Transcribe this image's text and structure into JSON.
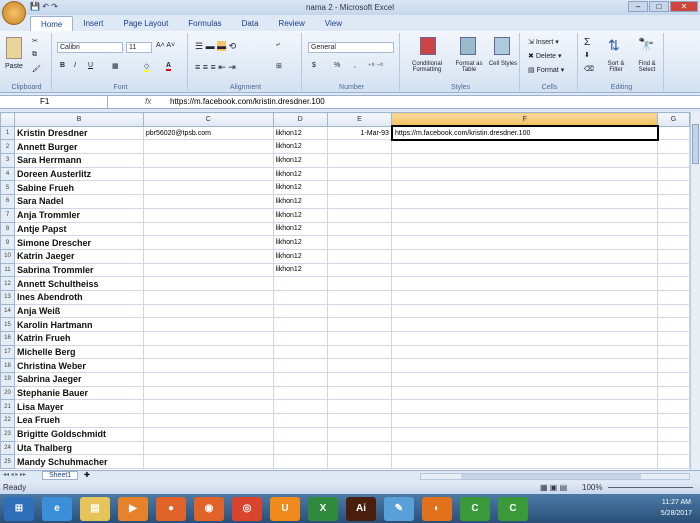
{
  "window": {
    "title": "nama 2 - Microsoft Excel"
  },
  "ribbon": {
    "tabs": [
      "Home",
      "Insert",
      "Page Layout",
      "Formulas",
      "Data",
      "Review",
      "View"
    ],
    "active_tab": "Home",
    "groups": {
      "clipboard": "Clipboard",
      "font": "Font",
      "alignment": "Alignment",
      "number": "Number",
      "styles": "Styles",
      "cells": "Cells",
      "editing": "Editing"
    },
    "paste": "Paste",
    "font_name": "Calibri",
    "font_size": "11",
    "number_format": "General",
    "conditional_formatting": "Conditional Formatting",
    "format_as_table": "Format as Table",
    "cell_styles": "Cell Styles",
    "insert": "Insert",
    "delete": "Delete",
    "format": "Format",
    "sort_filter": "Sort & Filter",
    "find_select": "Find & Select",
    "bold": "B",
    "italic": "I",
    "underline": "U",
    "currency": "$",
    "percent": "%",
    "comma": ","
  },
  "formula_bar": {
    "cell_ref": "F1",
    "fx": "fx",
    "value": "https://m.facebook.com/kristin.dresdner.100"
  },
  "columns": [
    "B",
    "C",
    "D",
    "E",
    "F",
    "G"
  ],
  "selected_column": "F",
  "rows": [
    {
      "n": "1",
      "b": "Kristin Dresdner",
      "c": "pbr56020@tpsb.com",
      "d": "likhon12",
      "e": "1-Mar-93",
      "f": "https://m.facebook.com/kristin.dresdner.100"
    },
    {
      "n": "2",
      "b": "Annett Burger",
      "d": "likhon12"
    },
    {
      "n": "3",
      "b": "Sara Herrmann",
      "d": "likhon12"
    },
    {
      "n": "4",
      "b": "Doreen Austerlitz",
      "d": "likhon12"
    },
    {
      "n": "5",
      "b": "Sabine Frueh",
      "d": "likhon12"
    },
    {
      "n": "6",
      "b": "Sara Nadel",
      "d": "likhon12"
    },
    {
      "n": "7",
      "b": "Anja Trommler",
      "d": "likhon12"
    },
    {
      "n": "8",
      "b": "Antje Papst",
      "d": "likhon12"
    },
    {
      "n": "9",
      "b": "Simone Drescher",
      "d": "likhon12"
    },
    {
      "n": "10",
      "b": "Katrin Jaeger",
      "d": "likhon12"
    },
    {
      "n": "11",
      "b": "Sabrina Trommler",
      "d": "likhon12"
    },
    {
      "n": "12",
      "b": "Annett Schultheiss"
    },
    {
      "n": "13",
      "b": "Ines Abendroth"
    },
    {
      "n": "14",
      "b": "Anja Weiß"
    },
    {
      "n": "15",
      "b": "Karolin Hartmann"
    },
    {
      "n": "16",
      "b": "Katrin Frueh"
    },
    {
      "n": "17",
      "b": "Michelle Berg"
    },
    {
      "n": "18",
      "b": "Christina Weber"
    },
    {
      "n": "19",
      "b": "Sabrina Jaeger"
    },
    {
      "n": "20",
      "b": "Stephanie Bauer"
    },
    {
      "n": "21",
      "b": "Lisa Mayer"
    },
    {
      "n": "22",
      "b": "Lea Frueh"
    },
    {
      "n": "23",
      "b": "Brigitte Goldschmidt"
    },
    {
      "n": "24",
      "b": "Uta Thalberg"
    },
    {
      "n": "25",
      "b": "Mandy Schuhmacher"
    }
  ],
  "sheet_tab": "Sheet1",
  "status": {
    "text": "Ready",
    "zoom": "100%"
  },
  "taskbar": {
    "time": "11:27 AM",
    "date": "5/28/2017",
    "apps": [
      {
        "name": "start",
        "color": "#2f6fb8",
        "glyph": "⊞"
      },
      {
        "name": "internet-explorer",
        "color": "#3a8fd8",
        "glyph": "e"
      },
      {
        "name": "file-explorer",
        "color": "#e7c45a",
        "glyph": "▤"
      },
      {
        "name": "media-player",
        "color": "#e8822a",
        "glyph": "▶"
      },
      {
        "name": "recorder",
        "color": "#e0642a",
        "glyph": "●"
      },
      {
        "name": "camera-app",
        "color": "#e0642a",
        "glyph": "◉"
      },
      {
        "name": "chrome",
        "color": "#d9442f",
        "glyph": "◎"
      },
      {
        "name": "uc-browser",
        "color": "#f08a1c",
        "glyph": "U"
      },
      {
        "name": "excel",
        "color": "#2f8a3d",
        "glyph": "X"
      },
      {
        "name": "illustrator",
        "color": "#4a1e0c",
        "glyph": "Ai"
      },
      {
        "name": "app-pen",
        "color": "#5aa0d8",
        "glyph": "✎"
      },
      {
        "name": "firefox",
        "color": "#e3711c",
        "glyph": "◐"
      },
      {
        "name": "camtasia",
        "color": "#3a9a3a",
        "glyph": "C"
      },
      {
        "name": "camtasia-recorder",
        "color": "#3a9a3a",
        "glyph": "C"
      }
    ]
  }
}
